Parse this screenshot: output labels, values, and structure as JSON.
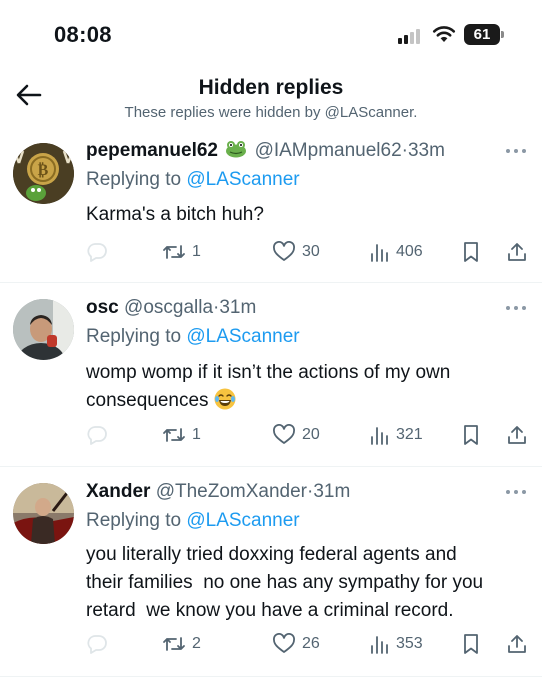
{
  "status_bar": {
    "time": "08:08",
    "battery": "61",
    "signal_icon": "cellular-signal-icon",
    "wifi_icon": "wifi-icon"
  },
  "header": {
    "title": "Hidden replies",
    "subtitle": "These replies were hidden by @LAScanner.",
    "back_icon": "back-arrow-icon"
  },
  "colors": {
    "accent": "#1d9bf0",
    "secondary_text": "#536471",
    "primary_text": "#0f1419",
    "divider": "#eff3f4"
  },
  "replies": [
    {
      "name": "pepemanuel62",
      "handle": "@IAMpmanuel62",
      "time": "33m",
      "replying_prefix": "Replying to",
      "replying_to": "@LAScanner",
      "text": "Karma's a bitch huh?",
      "retweets": "1",
      "likes": "30",
      "views": "406"
    },
    {
      "name": "osc",
      "handle": "@oscgalla",
      "time": "31m",
      "replying_prefix": "Replying to",
      "replying_to": "@LAScanner",
      "text_line1": "womp womp if it isn’t the actions of my own",
      "text_line2": "consequences",
      "retweets": "1",
      "likes": "20",
      "views": "321"
    },
    {
      "name": "Xander",
      "handle": "@TheZomXander",
      "time": "31m",
      "replying_prefix": "Replying to",
      "replying_to": "@LAScanner",
      "text_line1": "you literally tried doxxing federal agents and",
      "text_line2": "their families  no one has any sympathy for you",
      "text_line3": "retard  we know you have a criminal record.",
      "retweets": "2",
      "likes": "26",
      "views": "353"
    }
  ]
}
